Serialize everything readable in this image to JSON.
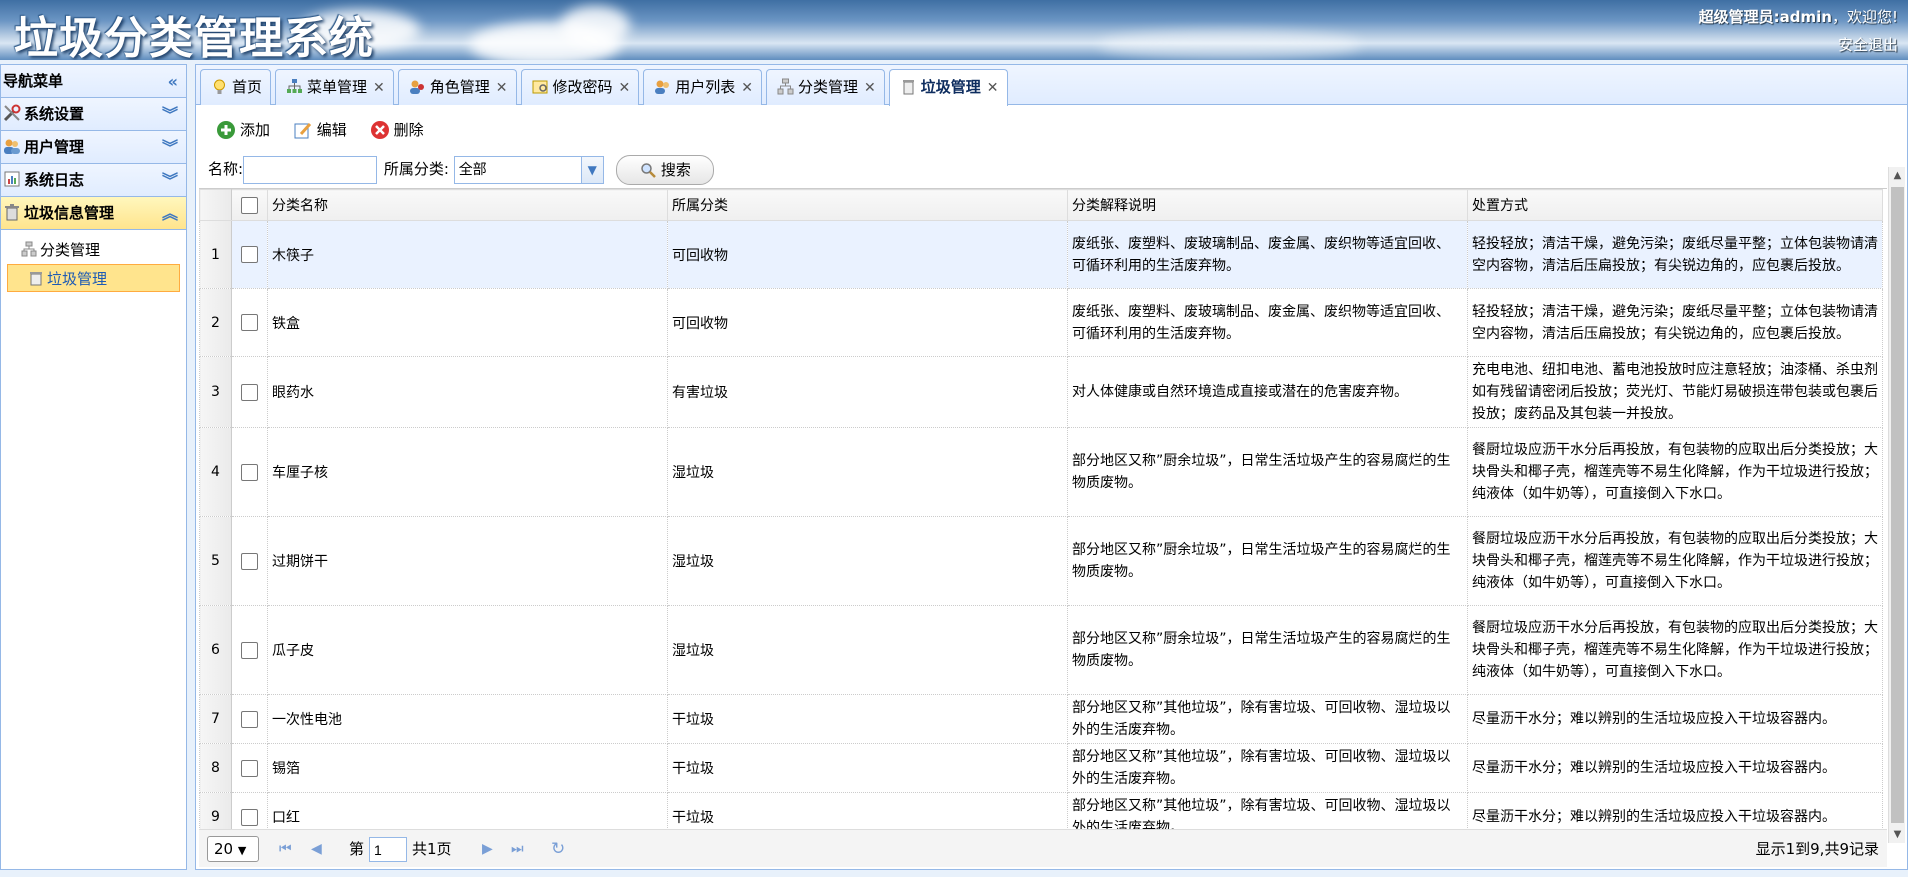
{
  "header": {
    "title": "垃圾分类管理系统",
    "welcome_user": "超级管理员:admin",
    "welcome_tail": "，欢迎您!",
    "logout": "安全退出"
  },
  "sidebar": {
    "title": "导航菜单",
    "groups": [
      {
        "label": "系统设置",
        "icon": "tools-icon"
      },
      {
        "label": "用户管理",
        "icon": "users-icon"
      },
      {
        "label": "系统日志",
        "icon": "log-icon"
      },
      {
        "label": "垃圾信息管理",
        "icon": "trash-icon"
      }
    ],
    "tree_items": [
      {
        "label": "分类管理",
        "icon": "category-icon"
      },
      {
        "label": "垃圾管理",
        "icon": "trash-can-icon"
      }
    ]
  },
  "tabs": [
    {
      "label": "首页",
      "closable": false
    },
    {
      "label": "菜单管理",
      "closable": true
    },
    {
      "label": "角色管理",
      "closable": true
    },
    {
      "label": "修改密码",
      "closable": true
    },
    {
      "label": "用户列表",
      "closable": true
    },
    {
      "label": "分类管理",
      "closable": true
    },
    {
      "label": "垃圾管理",
      "closable": true
    }
  ],
  "toolbar": {
    "add": "添加",
    "edit": "编辑",
    "delete": "删除"
  },
  "search": {
    "name_label": "名称:",
    "name_value": "",
    "category_label": "所属分类:",
    "category_selected": "全部",
    "search_button": "搜索"
  },
  "grid": {
    "columns": [
      "分类名称",
      "所属分类",
      "分类解释说明",
      "处置方式"
    ],
    "rows": [
      {
        "num": "1",
        "name": "木筷子",
        "category": "可回收物",
        "desc": "废纸张、废塑料、废玻璃制品、废金属、废织物等适宜回收、可循环利用的生活废弃物。",
        "disposal": "轻投轻放；清洁干燥，避免污染；废纸尽量平整；立体包装物请清空内容物，清洁后压扁投放；有尖锐边角的，应包裹后投放。"
      },
      {
        "num": "2",
        "name": "铁盒",
        "category": "可回收物",
        "desc": "废纸张、废塑料、废玻璃制品、废金属、废织物等适宜回收、可循环利用的生活废弃物。",
        "disposal": "轻投轻放；清洁干燥，避免污染；废纸尽量平整；立体包装物请清空内容物，清洁后压扁投放；有尖锐边角的，应包裹后投放。"
      },
      {
        "num": "3",
        "name": "眼药水",
        "category": "有害垃圾",
        "desc": "对人体健康或自然环境造成直接或潜在的危害废弃物。",
        "disposal": "充电电池、纽扣电池、蓄电池投放时应注意轻放；油漆桶、杀虫剂如有残留请密闭后投放；荧光灯、节能灯易破损连带包装或包裹后投放；废药品及其包装一并投放。"
      },
      {
        "num": "4",
        "name": "车厘子核",
        "category": "湿垃圾",
        "desc": "部分地区又称”厨余垃圾”，日常生活垃圾产生的容易腐烂的生物质废物。",
        "disposal": "餐厨垃圾应沥干水分后再投放，有包装物的应取出后分类投放；大块骨头和椰子壳，榴莲壳等不易生化降解，作为干垃圾进行投放；纯液体（如牛奶等），可直接倒入下水口。"
      },
      {
        "num": "5",
        "name": "过期饼干",
        "category": "湿垃圾",
        "desc": "部分地区又称”厨余垃圾”，日常生活垃圾产生的容易腐烂的生物质废物。",
        "disposal": "餐厨垃圾应沥干水分后再投放，有包装物的应取出后分类投放；大块骨头和椰子壳，榴莲壳等不易生化降解，作为干垃圾进行投放；纯液体（如牛奶等），可直接倒入下水口。"
      },
      {
        "num": "6",
        "name": "瓜子皮",
        "category": "湿垃圾",
        "desc": "部分地区又称”厨余垃圾”，日常生活垃圾产生的容易腐烂的生物质废物。",
        "disposal": "餐厨垃圾应沥干水分后再投放，有包装物的应取出后分类投放；大块骨头和椰子壳，榴莲壳等不易生化降解，作为干垃圾进行投放；纯液体（如牛奶等），可直接倒入下水口。"
      },
      {
        "num": "7",
        "name": "一次性电池",
        "category": "干垃圾",
        "desc": "部分地区又称”其他垃圾”，除有害垃圾、可回收物、湿垃圾以外的生活废弃物。",
        "disposal": "尽量沥干水分；难以辨别的生活垃圾应投入干垃圾容器内。"
      },
      {
        "num": "8",
        "name": "锡箔",
        "category": "干垃圾",
        "desc": "部分地区又称”其他垃圾”，除有害垃圾、可回收物、湿垃圾以外的生活废弃物。",
        "disposal": "尽量沥干水分；难以辨别的生活垃圾应投入干垃圾容器内。"
      },
      {
        "num": "9",
        "name": "口红",
        "category": "干垃圾",
        "desc": "部分地区又称”其他垃圾”，除有害垃圾、可回收物、湿垃圾以外的生活废弃物。",
        "disposal": "尽量沥干水分；难以辨别的生活垃圾应投入干垃圾容器内。"
      }
    ]
  },
  "pager": {
    "page_size": "20",
    "page_label": "第",
    "page_number": "1",
    "page_total": "共1页",
    "info": "显示1到9,共9记录"
  },
  "colors": {
    "border": "#95b8e7",
    "active_menu": "#ffe48d",
    "header_sky": "#5f8dbe"
  }
}
